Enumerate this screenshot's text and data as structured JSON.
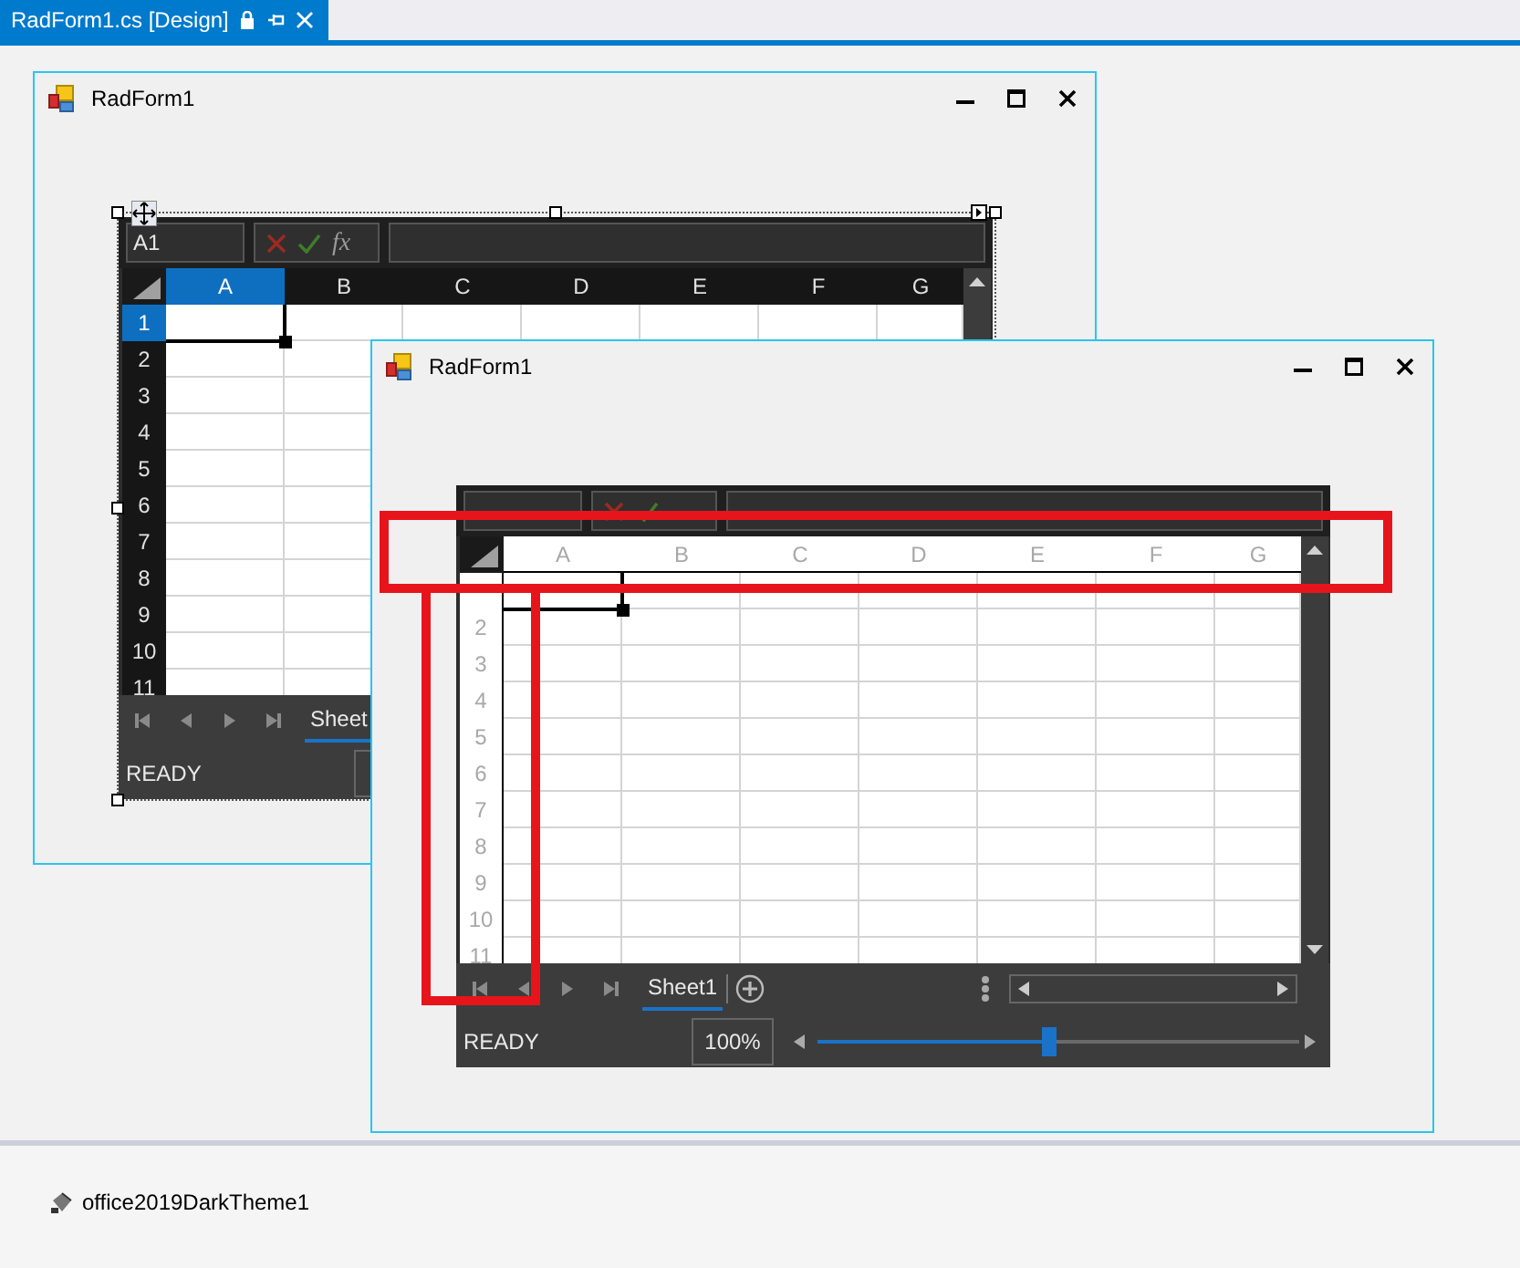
{
  "document_tab": {
    "title": "RadForm1.cs [Design]",
    "selected": true
  },
  "forms": [
    {
      "title": "RadForm1",
      "designer_selected": true,
      "spreadsheet": {
        "kind": "dark",
        "name_box": "A1",
        "formula_label": "fx",
        "selection_visible": true,
        "columns": [
          {
            "label": "A",
            "selected": true
          },
          {
            "label": "B",
            "selected": false
          },
          {
            "label": "C",
            "selected": false
          },
          {
            "label": "D",
            "selected": false
          },
          {
            "label": "E",
            "selected": false
          },
          {
            "label": "F",
            "selected": false
          },
          {
            "label": "G",
            "selected": false
          }
        ],
        "rows": [
          {
            "label": "1",
            "selected": true
          },
          {
            "label": "2",
            "selected": false
          },
          {
            "label": "3",
            "selected": false
          },
          {
            "label": "4",
            "selected": false
          },
          {
            "label": "5",
            "selected": false
          },
          {
            "label": "6",
            "selected": false
          },
          {
            "label": "7",
            "selected": false
          },
          {
            "label": "8",
            "selected": false
          },
          {
            "label": "9",
            "selected": false
          },
          {
            "label": "10",
            "selected": false
          },
          {
            "label": "11",
            "selected": false
          }
        ],
        "sheet_tabs": [
          {
            "label": "Sheet",
            "selected": true
          }
        ],
        "status": "READY"
      }
    },
    {
      "title": "RadForm1",
      "designer_selected": false,
      "spreadsheet": {
        "kind": "light",
        "selection_visible": true,
        "columns": [
          {
            "label": "A"
          },
          {
            "label": "B"
          },
          {
            "label": "C"
          },
          {
            "label": "D"
          },
          {
            "label": "E"
          },
          {
            "label": "F"
          },
          {
            "label": "G"
          }
        ],
        "rows": [
          {},
          {
            "label": "2"
          },
          {
            "label": "3"
          },
          {
            "label": "4"
          },
          {
            "label": "5"
          },
          {
            "label": "6"
          },
          {
            "label": "7"
          },
          {
            "label": "8"
          },
          {
            "label": "9"
          },
          {
            "label": "10"
          },
          {
            "label": "11"
          }
        ],
        "sheet_tabs": [
          {
            "label": "Sheet1",
            "selected": true
          }
        ],
        "status": "READY",
        "zoom": "100%",
        "zoom_slider": {
          "level": 0.48
        }
      }
    }
  ],
  "component_tray": [
    {
      "label": "office2019DarkTheme1"
    }
  ]
}
